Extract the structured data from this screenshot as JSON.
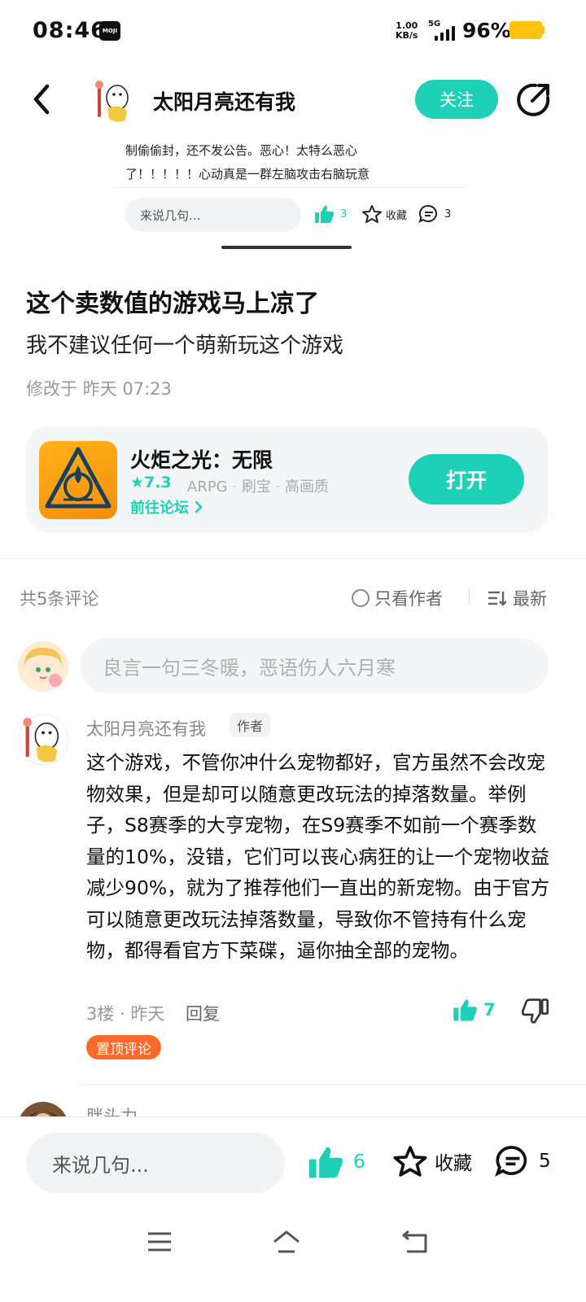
{
  "status_bar": {
    "time": "08:46",
    "app_badge": "MOJI",
    "net_speed_value": "1.00",
    "net_speed_unit": "KB/s",
    "network_type": "5G",
    "battery_percent": "96%",
    "battery_level": 0.96
  },
  "header": {
    "author_name": "太阳月亮还有我",
    "follow_label": "关注"
  },
  "preview": {
    "text_line1": "制偷偷封，还不发公告。恶心！太特么恶心",
    "text_line2": "了！！！！！心动真是一群左脑攻击右脑玩意",
    "input_placeholder": "来说几句...",
    "like_count": "3",
    "favorite_label": "收藏",
    "comment_count": "3"
  },
  "post": {
    "title": "这个卖数值的游戏马上凉了",
    "subtitle": "我不建议任何一个萌新玩这个游戏",
    "modified": "修改于 昨天 07:23"
  },
  "game": {
    "name": "火炬之光：无限",
    "rating": "7.3",
    "tags": [
      "ARPG",
      "刷宝",
      "高画质"
    ],
    "forum_link": "前往论坛",
    "open_label": "打开"
  },
  "comments_header": {
    "count_label": "共5条评论",
    "only_author_label": "只看作者",
    "sort_label": "最新"
  },
  "comment_input": {
    "placeholder": "良言一句三冬暖，恶语伤人六月寒"
  },
  "comments": [
    {
      "author": "太阳月亮还有我",
      "badge": "作者",
      "body": "这个游戏，不管你冲什么宠物都好，官方虽然不会改宠物效果，但是却可以随意更改玩法的掉落数量。举例子，S8赛季的大亨宠物，在S9赛季不如前一个赛季数量的10%，没错，它们可以丧心病狂的让一个宠物收益减少90%，就为了推荐他们一直出的新宠物。由于官方可以随意更改玩法掉落数量，导致你不管持有什么宠物，都得看官方下菜碟，逼你抽全部的宠物。",
      "floor_time": "3楼 · 昨天",
      "reply_label": "回复",
      "like_count": "7",
      "pin_label": "置顶评论"
    },
    {
      "author": "胖头力"
    }
  ],
  "bottom_bar": {
    "input_placeholder": "来说几句...",
    "like_count": "6",
    "favorite_label": "收藏",
    "comment_count": "5"
  },
  "colors": {
    "accent": "#1ed0b6",
    "pin": "#ff6a2b",
    "battery": "#ffc20e"
  },
  "icons": [
    "back-icon",
    "share-icon",
    "thumbs-up-icon",
    "star-icon",
    "comment-bubble-icon",
    "thumbs-down-icon",
    "sort-icon",
    "menu-icon",
    "home-icon",
    "return-icon"
  ]
}
